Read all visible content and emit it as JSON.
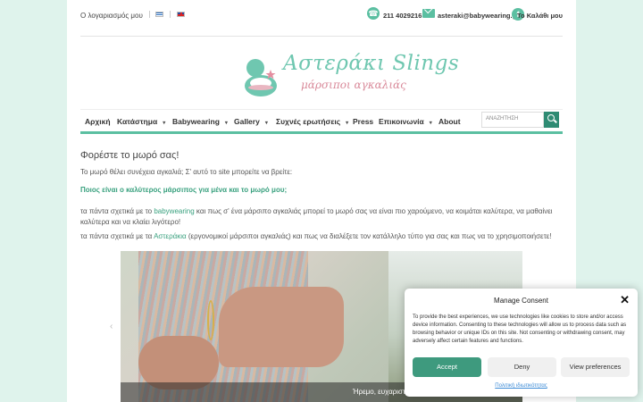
{
  "topbar": {
    "account": "Ο λογαριασμός μου",
    "phone": "211 4029216",
    "email": "asteraki@babywearing.gr",
    "cart": "Το Καλάθι μου"
  },
  "logo": {
    "title": "Αστεράκι Slings",
    "subtitle": "μάρσιποι αγκαλιάς"
  },
  "nav": {
    "items": [
      {
        "label": "Αρχική"
      },
      {
        "label": "Κατάστημα",
        "caret": "▾"
      },
      {
        "label": "Babywearing",
        "caret": "▾"
      },
      {
        "label": "Gallery",
        "caret": "▾"
      },
      {
        "label": "Συχνές ερωτήσεις",
        "caret": "▾"
      },
      {
        "label": "Press"
      },
      {
        "label": "Επικοινωνία",
        "caret": "▾"
      },
      {
        "label": "About"
      }
    ],
    "search_placeholder": "ΑΝΑΖΗΤΗΣΗ"
  },
  "content": {
    "title": "Φορέστε το μωρό σας!",
    "p1": "Το μωρό θέλει συνέχεια αγκαλιά; Σ' αυτό το site μπορείτε να βρείτε:",
    "p_green": "Ποιος είναι ο καλύτερος μάρσιπος για μένα και το μωρό μου;",
    "p2_before": "τα πάντα σχετικά με το ",
    "p2_link": "babywearing",
    "p2_after": " και πως σ' ένα μάρσιπο αγκαλιάς μπορεί το μωρό σας να είναι πιο χαρούμενο, να κοιμάται καλύτερα, να μαθαίνει καλύτερα και να κλαίει λιγότερο!",
    "p3_before": "τα πάντα σχετικά με τα ",
    "p3_link": "Αστεράκια",
    "p3_after": " (εργονομικοί μάρσιποι αγκαλιάς) και πως να διαλέξετε τον κατάλληλο τύπο για σας και πως να το χρησιμοποιήσετε!"
  },
  "slider": {
    "caption": "Ήρεμο, ευχαριστημένο μωρό, με ευκολία και άνεση",
    "prev": "‹"
  },
  "consent": {
    "title": "Manage Consent",
    "close": "✕",
    "text": "To provide the best experiences, we use technologies like cookies to store and/or access device information. Consenting to these technologies will allow us to process data such as browsing behavior or unique IDs on this site. Not consenting or withdrawing consent, may adversely affect certain features and functions.",
    "accept": "Accept",
    "deny": "Deny",
    "prefs": "View preferences",
    "link": "Πολιτική ιδιωτικότητας"
  },
  "colors": {
    "accent": "#5bbfa1",
    "accent_dark": "#3e9a7e",
    "background": "#dff3ec"
  }
}
